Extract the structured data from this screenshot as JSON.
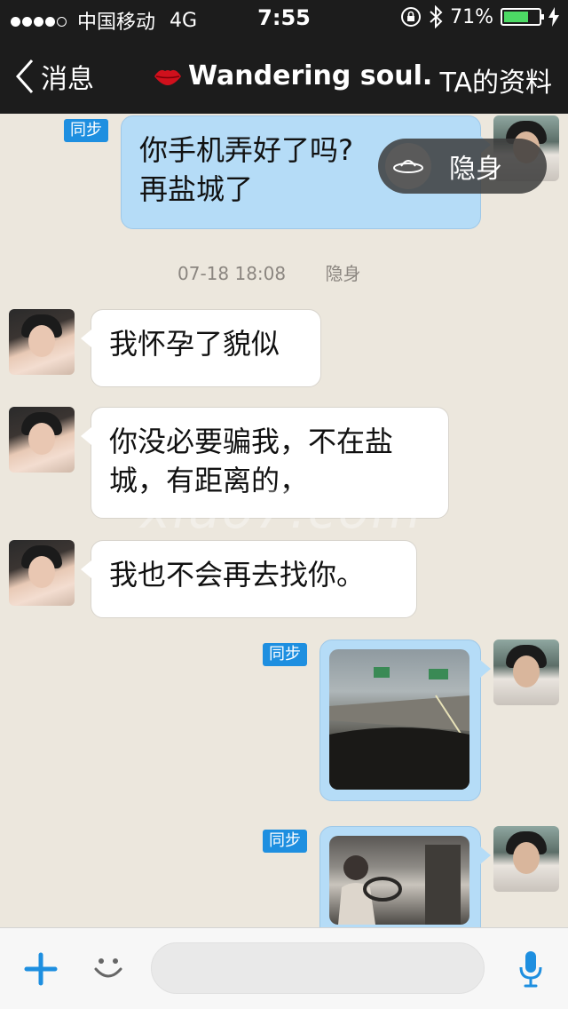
{
  "status_bar": {
    "carrier": "中国移动",
    "network": "4G",
    "time": "7:55",
    "battery": "71%",
    "battery_fill": 0.71
  },
  "nav": {
    "back_label": "消息",
    "title": "Wandering soul.",
    "profile_label": "TA的资料"
  },
  "messages": {
    "msg1": {
      "line1": "你手机弄好了吗?",
      "line2": "再盐城了",
      "tag": "同步"
    },
    "stealth_pill": "隐身",
    "timestamp": "07-18 18:08",
    "timestamp_status": "隐身",
    "msg2": "我怀孕了貌似",
    "msg3": {
      "line1": "你没必要骗我，不在盐",
      "line2": "城，有距离的，"
    },
    "msg4": "我也不会再去找你。",
    "img1_tag": "同步",
    "img2_tag": "同步"
  },
  "watermark": "xiao7.com",
  "colors": {
    "header_bg": "#1c1c1c",
    "chat_bg": "#ece7dd",
    "outgoing_bubble": "#b5dcf7",
    "incoming_bubble": "#ffffff",
    "sync_tag": "#1e8fe0",
    "battery_green": "#4cd964"
  }
}
